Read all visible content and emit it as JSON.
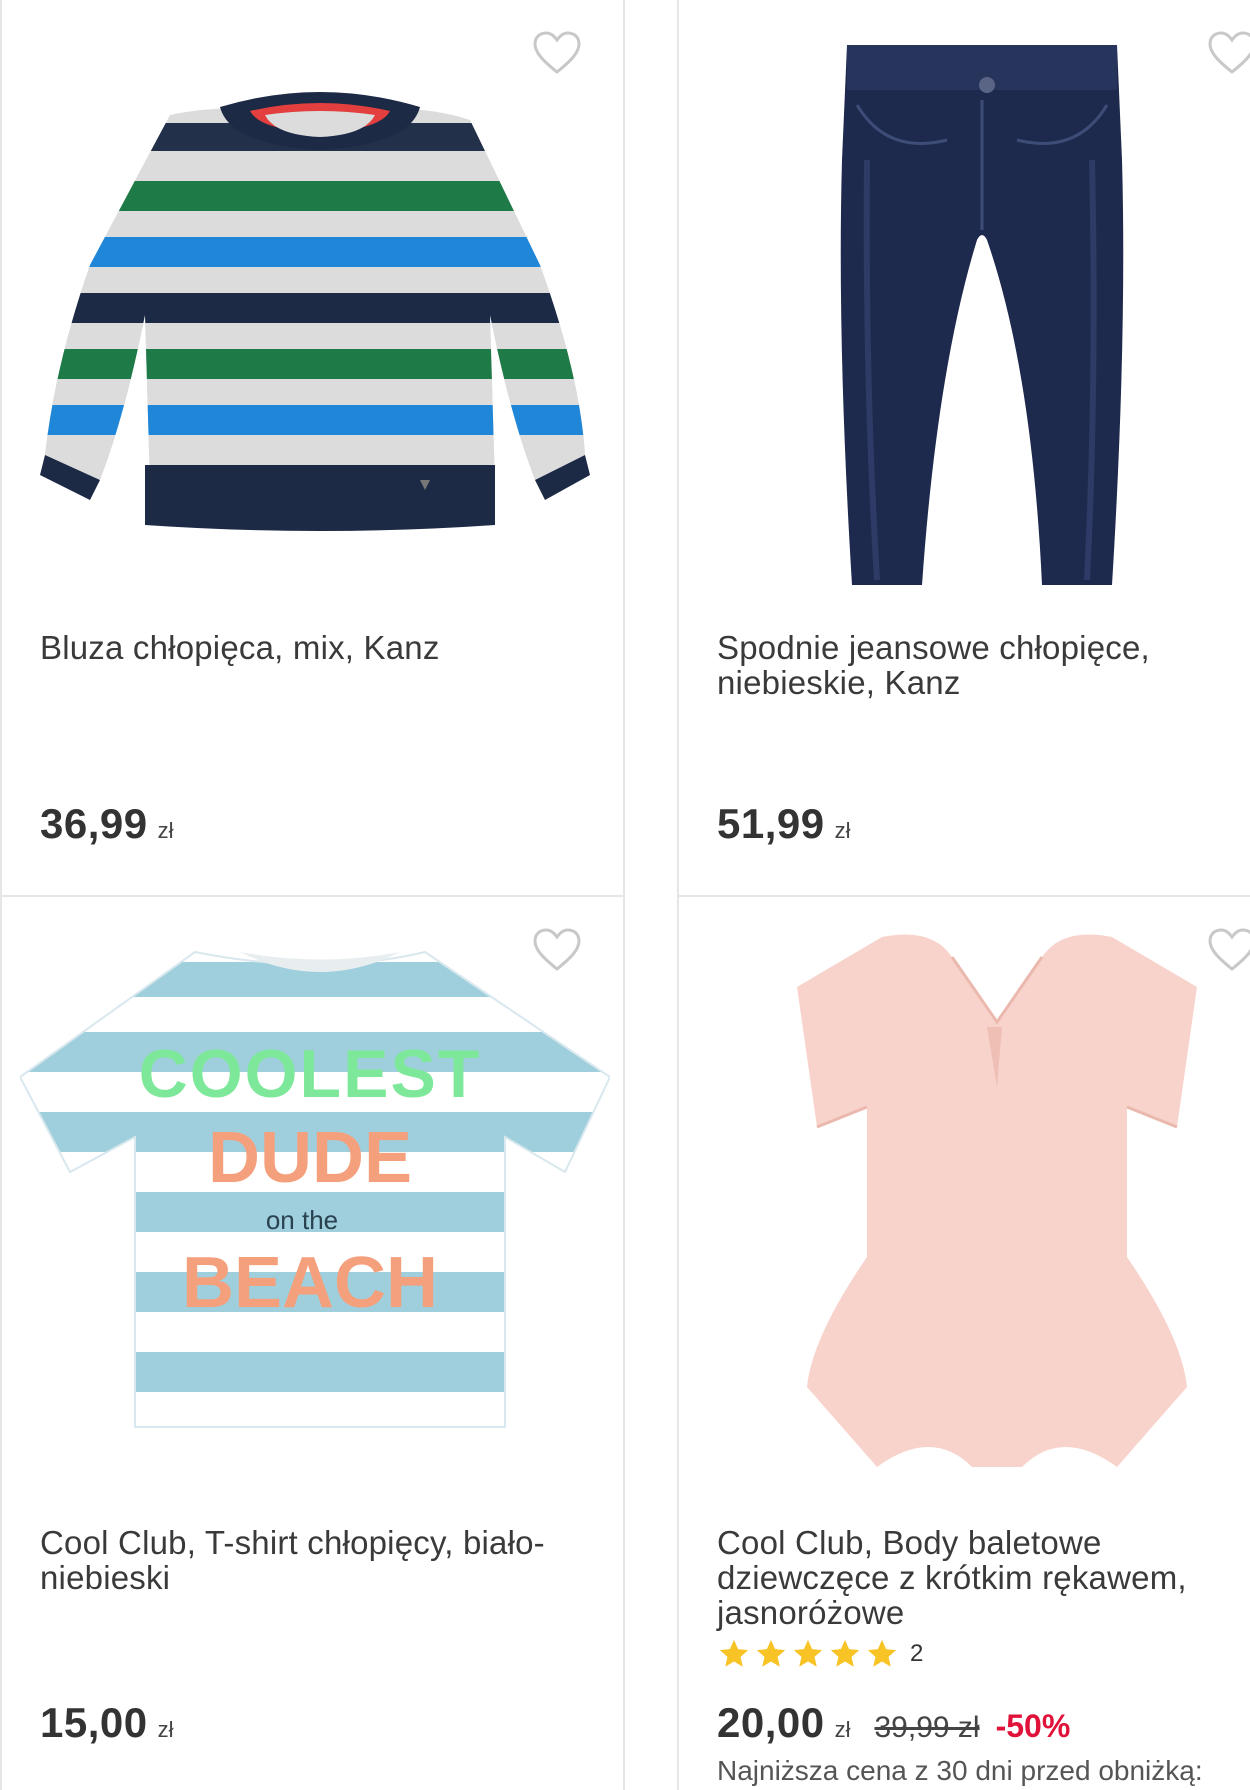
{
  "products": [
    {
      "title": "Bluza chłopięca, mix, Kanz",
      "price": "36,99",
      "currency": "zł"
    },
    {
      "title": "Spodnie jeansowe chłopięce, niebieskie, Kanz",
      "price": "51,99",
      "currency": "zł"
    },
    {
      "title": "Cool Club, T-shirt chłopięcy, biało-niebieski",
      "price": "15,00",
      "currency": "zł",
      "graphic": {
        "line1": "COOLEST",
        "line2": "DUDE",
        "line3": "on the",
        "line4": "BEACH"
      }
    },
    {
      "title": "Cool Club, Body baletowe dziewczęce z krótkim rękawem, jasnoróżowe",
      "price": "20,00",
      "currency": "zł",
      "old_price": "39,99 zł",
      "discount": "-50%",
      "rating": 5,
      "reviews": "2",
      "lowest_price_note": "Najniższa cena z 30 dni przed obniżką:"
    }
  ],
  "colors": {
    "accent": "#e0123a",
    "star": "#f7c325"
  },
  "icons": {
    "favorite": "heart-outline-icon",
    "rating": "star-icon"
  }
}
